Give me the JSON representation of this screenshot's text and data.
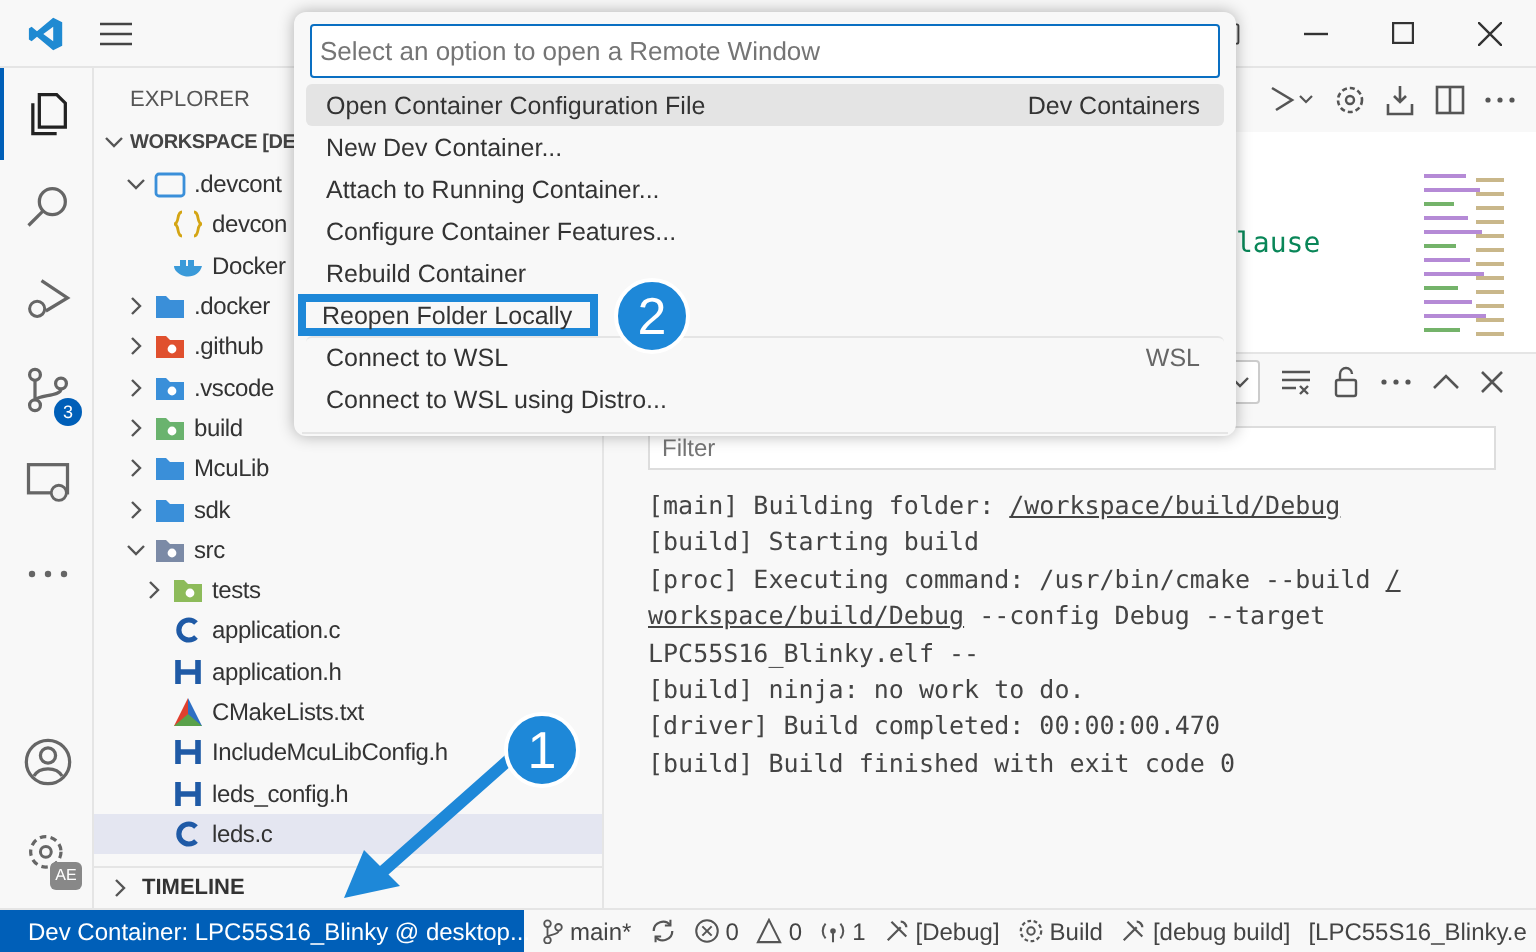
{
  "activity_bar": [
    {
      "kind": "files",
      "selected": true
    },
    {
      "kind": "search",
      "selected": false
    },
    {
      "kind": "run",
      "selected": false
    },
    {
      "kind": "scm",
      "selected": false,
      "badge": "3"
    },
    {
      "kind": "remote",
      "selected": false
    },
    {
      "kind": "more",
      "selected": false
    }
  ],
  "activity_bottom": [
    {
      "kind": "account"
    },
    {
      "kind": "manage",
      "badge": "AE"
    }
  ],
  "sidebar": {
    "title": "EXPLORER",
    "workspace": "WORKSPACE [DE",
    "tree": [
      {
        "label": ".devcont",
        "kind": "openfolder",
        "expanded": true,
        "children": [
          {
            "label": "devcon",
            "kind": "json"
          },
          {
            "label": "Docker",
            "kind": "docker"
          }
        ]
      },
      {
        "label": ".docker",
        "kind": "folder",
        "expanded": false
      },
      {
        "label": ".github",
        "kind": "github",
        "expanded": false
      },
      {
        "label": ".vscode",
        "kind": "vscode",
        "expanded": false
      },
      {
        "label": "build",
        "kind": "build",
        "expanded": false
      },
      {
        "label": "McuLib",
        "kind": "folder",
        "expanded": false
      },
      {
        "label": "sdk",
        "kind": "folder",
        "expanded": false
      },
      {
        "label": "src",
        "kind": "src",
        "expanded": true,
        "children": [
          {
            "label": "tests",
            "kind": "tests",
            "expanded": false
          },
          {
            "label": "application.c",
            "kind": "c"
          },
          {
            "label": "application.h",
            "kind": "h"
          },
          {
            "label": "CMakeLists.txt",
            "kind": "cmake"
          },
          {
            "label": "IncludeMcuLibConfig.h",
            "kind": "h"
          },
          {
            "label": "leds_config.h",
            "kind": "h"
          },
          {
            "label": "leds.c",
            "kind": "c",
            "selected": true
          }
        ]
      }
    ],
    "timeline": "TIMELINE"
  },
  "editor": {
    "code_fragment": "lause"
  },
  "quick_pick": {
    "placeholder": "Select an option to open a Remote Window",
    "items": [
      {
        "label": "Open Container Configuration File",
        "detail": "Dev Containers",
        "selected": true,
        "marked": false
      },
      {
        "label": "New Dev Container...",
        "selected": false,
        "marked": false
      },
      {
        "label": "Attach to Running Container...",
        "selected": false,
        "marked": false
      },
      {
        "label": "Configure Container Features...",
        "selected": false,
        "marked": false
      },
      {
        "label": "Rebuild Container",
        "selected": false,
        "marked": false
      },
      {
        "label": "Reopen Folder Locally",
        "selected": false,
        "marked": true
      },
      {
        "label": "Connect to WSL",
        "detail": "WSL",
        "selected": false,
        "marked": false
      },
      {
        "label": "Connect to WSL using Distro...",
        "selected": false,
        "marked": false
      }
    ]
  },
  "output": {
    "filter_placeholder": "Filter",
    "lines": [
      [
        {
          "text": "[main] Building folder: ",
          "link": false
        },
        {
          "text": "/workspace/build/Debug",
          "link": true
        }
      ],
      [
        {
          "text": "[build] Starting build",
          "link": false
        }
      ],
      [
        {
          "text": "[proc] Executing command: /usr/bin/cmake --build ",
          "link": false
        },
        {
          "text": "/",
          "link": true
        }
      ],
      [
        {
          "text": "workspace/build/Debug",
          "link": true
        },
        {
          "text": " --config Debug --target",
          "link": false
        }
      ],
      [
        {
          "text": "LPC55S16_Blinky.elf --",
          "link": false
        }
      ],
      [
        {
          "text": "[build] ninja: no work to do.",
          "link": false
        }
      ],
      [
        {
          "text": "[driver] Build completed: 00:00:00.470",
          "link": false
        }
      ],
      [
        {
          "text": "[build] Build finished with exit code 0",
          "link": false
        }
      ]
    ]
  },
  "status_bar": {
    "remote": "Dev Container: LPC55S16_Blinky @ desktop...",
    "items": [
      {
        "kind": "branch",
        "text": "main*"
      },
      {
        "kind": "sync"
      },
      {
        "kind": "error",
        "text": "0"
      },
      {
        "kind": "warning",
        "text": "0"
      },
      {
        "kind": "ports",
        "text": "1"
      },
      {
        "kind": "tools",
        "text": "[Debug]"
      },
      {
        "kind": "gear",
        "text": "Build"
      },
      {
        "kind": "tools",
        "text": "[debug build]"
      },
      {
        "kind": "plain",
        "text": "[LPC55S16_Blinky.e"
      }
    ]
  },
  "callouts": [
    "1",
    "2"
  ]
}
